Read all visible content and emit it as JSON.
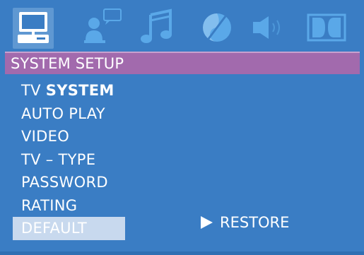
{
  "colors": {
    "background": "#3a7dc4",
    "title_bar": "#a26aad",
    "selected_highlight": "#c8d9ee",
    "icon_active": "#ffffff",
    "icon_inactive": "#5aa8e8"
  },
  "icons": [
    {
      "name": "system-setup-icon",
      "active": true
    },
    {
      "name": "language-setup-icon",
      "active": false
    },
    {
      "name": "audio-setup-icon",
      "active": false
    },
    {
      "name": "video-setup-icon",
      "active": false
    },
    {
      "name": "speaker-setup-icon",
      "active": false
    },
    {
      "name": "dolby-digital-icon",
      "active": false
    }
  ],
  "title": "SYSTEM SETUP",
  "menu": {
    "items": [
      {
        "prefix": "TV ",
        "emphasis": "SYSTEM"
      },
      {
        "prefix": "AUTO PLAY",
        "emphasis": ""
      },
      {
        "prefix": "VIDEO",
        "emphasis": ""
      },
      {
        "prefix": "TV – TYPE",
        "emphasis": ""
      },
      {
        "prefix": "PASSWORD",
        "emphasis": ""
      },
      {
        "prefix": "RATING",
        "emphasis": ""
      },
      {
        "prefix": "DEFAULT",
        "emphasis": ""
      }
    ],
    "selected_index": 6
  },
  "option": {
    "label": "RESTORE",
    "icon": "right-arrow-icon"
  }
}
